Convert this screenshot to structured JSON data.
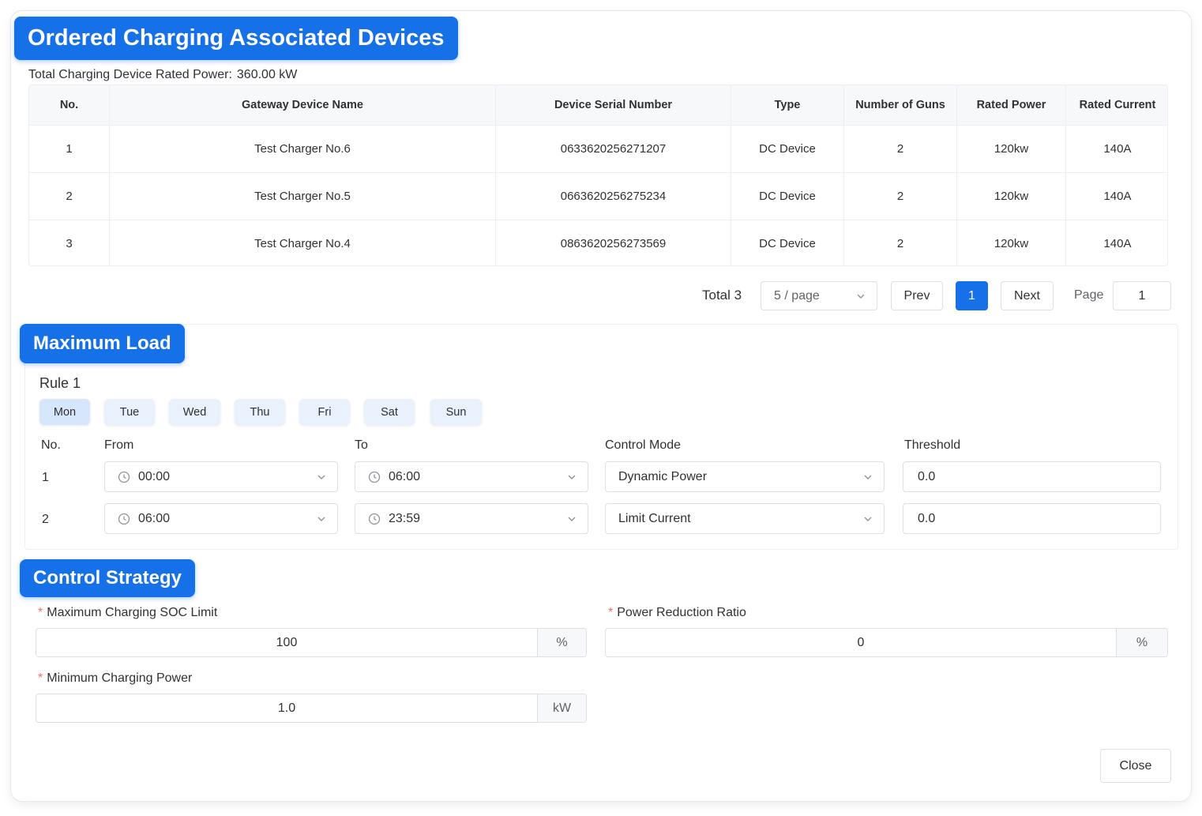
{
  "devices_section": {
    "title": "Ordered Charging Associated Devices",
    "total_power_label": "Total Charging Device Rated Power:",
    "total_power_value": "360.00 kW",
    "columns": [
      "No.",
      "Gateway Device Name",
      "Device Serial Number",
      "Type",
      "Number of Guns",
      "Rated Power",
      "Rated Current"
    ],
    "rows": [
      [
        "1",
        "Test Charger No.6",
        "0633620256271207",
        "DC Device",
        "2",
        "120kw",
        "140A"
      ],
      [
        "2",
        "Test Charger No.5",
        "0663620256275234",
        "DC Device",
        "2",
        "120kw",
        "140A"
      ],
      [
        "3",
        "Test Charger No.4",
        "0863620256273569",
        "DC Device",
        "2",
        "120kw",
        "140A"
      ]
    ]
  },
  "pagination": {
    "total": "Total 3",
    "page_size": "5 / page",
    "prev": "Prev",
    "current": "1",
    "next": "Next",
    "page_label": "Page",
    "page_input": "1"
  },
  "max_load": {
    "title": "Maximum Load",
    "rule_label": "Rule 1",
    "days": [
      "Mon",
      "Tue",
      "Wed",
      "Thu",
      "Fri",
      "Sat",
      "Sun"
    ],
    "active_day": "Mon",
    "headers": {
      "no": "No.",
      "from": "From",
      "to": "To",
      "mode": "Control Mode",
      "threshold": "Threshold"
    },
    "rows": [
      {
        "no": "1",
        "from": "00:00",
        "to": "06:00",
        "mode": "Dynamic Power",
        "threshold": "0.0"
      },
      {
        "no": "2",
        "from": "06:00",
        "to": "23:59",
        "mode": "Limit Current",
        "threshold": "0.0"
      }
    ]
  },
  "control_strategy": {
    "title": "Control Strategy",
    "required_mark": "*",
    "soc_label": "Maximum Charging SOC Limit",
    "soc_value": "100",
    "soc_unit": "%",
    "reduction_label": "Power Reduction Ratio",
    "reduction_value": "0",
    "reduction_unit": "%",
    "min_power_label": "Minimum Charging Power",
    "min_power_value": "1.0",
    "min_power_unit": "kW"
  },
  "footer": {
    "close_label": "Close"
  },
  "colors": {
    "primary": "#1670e8",
    "required": "#f56c6c",
    "border": "#dcdfe6"
  }
}
